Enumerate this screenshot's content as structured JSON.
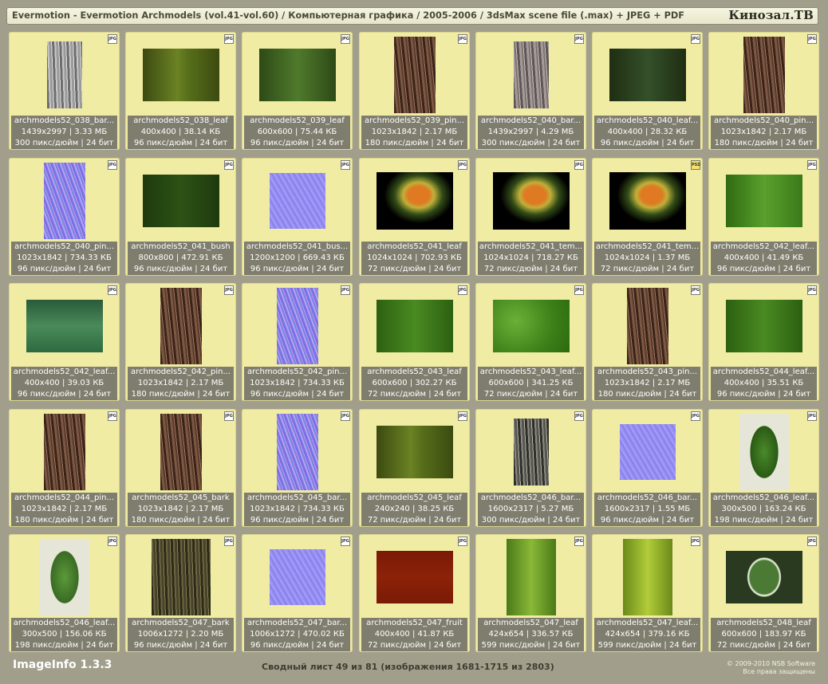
{
  "header": {
    "title": "Evermotion - Evermotion Archmodels (vol.41-vol.60) / Компьютерная графика / 2005-2006 / 3dsMax scene file (.max) + JPEG + PDF",
    "logo": "Кинозал.ТВ"
  },
  "items": [
    {
      "name": "archmodels52_038_bar...",
      "info": "1439x2997 | 3.33 МБ",
      "res": "300 пикс/дюйм | 24 бит",
      "badge": "JPG",
      "tex": "bark-gray"
    },
    {
      "name": "archmodels52_038_leaf",
      "info": "400x400 | 38.14 КБ",
      "res": "96 пикс/дюйм | 24 бит",
      "badge": "JPG",
      "tex": "green-olive"
    },
    {
      "name": "archmodels52_039_leaf",
      "info": "600x600 | 75.44 КБ",
      "res": "96 пикс/дюйм | 24 бит",
      "badge": "JPG",
      "tex": "green-mid"
    },
    {
      "name": "archmodels52_039_pin...",
      "info": "1023x1842 | 2.17 МБ",
      "res": "180 пикс/дюйм | 24 бит",
      "badge": "JPG",
      "tex": "bark-brown"
    },
    {
      "name": "archmodels52_040_bar...",
      "info": "1439x2997 | 4.29 МБ",
      "res": "300 пикс/дюйм | 24 бит",
      "badge": "JPG",
      "tex": "bark-gray-brown"
    },
    {
      "name": "archmodels52_040_leaf...",
      "info": "400x400 | 28.32 КБ",
      "res": "96 пикс/дюйм | 24 бит",
      "badge": "JPG",
      "tex": "green-dark"
    },
    {
      "name": "archmodels52_040_pin...",
      "info": "1023x1842 | 2.17 МБ",
      "res": "180 пикс/дюйм | 24 бит",
      "badge": "JPG",
      "tex": "bark-brown"
    },
    {
      "name": "archmodels52_040_pin...",
      "info": "1023x1842 | 734.33 КБ",
      "res": "96 пикс/дюйм | 24 бит",
      "badge": "JPG",
      "tex": "normal-blue"
    },
    {
      "name": "archmodels52_041_bush",
      "info": "800x800 | 472.91 КБ",
      "res": "96 пикс/дюйм | 24 бит",
      "badge": "JPG",
      "tex": "green-bush"
    },
    {
      "name": "archmodels52_041_bus...",
      "info": "1200x1200 | 669.43 КБ",
      "res": "96 пикс/дюйм | 24 бит",
      "badge": "JPG",
      "tex": "normal-lavender"
    },
    {
      "name": "archmodels52_041_leaf",
      "info": "1024x1024 | 702.93 КБ",
      "res": "72 пикс/дюйм | 24 бит",
      "badge": "JPG",
      "tex": "flower"
    },
    {
      "name": "archmodels52_041_tem...",
      "info": "1024x1024 | 718.27 КБ",
      "res": "72 пикс/дюйм | 24 бит",
      "badge": "JPG",
      "tex": "flower"
    },
    {
      "name": "archmodels52_041_tem...",
      "info": "1024x1024 | 1.37 МБ",
      "res": "72 пикс/дюйм | 24 бит",
      "badge": "PSD",
      "tex": "flower"
    },
    {
      "name": "archmodels52_042_leaf...",
      "info": "400x400 | 41.49 КБ",
      "res": "96 пикс/дюйм | 24 бит",
      "badge": "JPG",
      "tex": "green-bright"
    },
    {
      "name": "archmodels52_042_leaf...",
      "info": "400x400 | 39.03 КБ",
      "res": "96 пикс/дюйм | 24 бит",
      "badge": "JPG",
      "tex": "green-teal"
    },
    {
      "name": "archmodels52_042_pin...",
      "info": "1023x1842 | 2.17 МБ",
      "res": "180 пикс/дюйм | 24 бит",
      "badge": "JPG",
      "tex": "bark-brown"
    },
    {
      "name": "archmodels52_042_pin...",
      "info": "1023x1842 | 734.33 КБ",
      "res": "96 пикс/дюйм | 24 бит",
      "badge": "JPG",
      "tex": "normal-blue"
    },
    {
      "name": "archmodels52_043_leaf",
      "info": "600x600 | 302.27 КБ",
      "res": "72 пикс/дюйм | 24 бит",
      "badge": "JPG",
      "tex": "green-grass"
    },
    {
      "name": "archmodels52_043_leaf...",
      "info": "600x600 | 341.25 КБ",
      "res": "72 пикс/дюйм | 24 бит",
      "badge": "JPG",
      "tex": "green-moss"
    },
    {
      "name": "archmodels52_043_pin...",
      "info": "1023x1842 | 2.17 МБ",
      "res": "180 пикс/дюйм | 24 бит",
      "badge": "JPG",
      "tex": "bark-brown"
    },
    {
      "name": "archmodels52_044_leaf...",
      "info": "400x400 | 35.51 КБ",
      "res": "96 пикс/дюйм | 24 бит",
      "badge": "JPG",
      "tex": "green-grass"
    },
    {
      "name": "archmodels52_044_pin...",
      "info": "1023x1842 | 2.17 МБ",
      "res": "180 пикс/дюйм | 24 бит",
      "badge": "JPG",
      "tex": "bark-brown"
    },
    {
      "name": "archmodels52_045_bark",
      "info": "1023x1842 | 2.17 МБ",
      "res": "180 пикс/дюйм | 24 бит",
      "badge": "JPG",
      "tex": "bark-brown"
    },
    {
      "name": "archmodels52_045_bar...",
      "info": "1023x1842 | 734.33 КБ",
      "res": "96 пикс/дюйм | 24 бит",
      "badge": "JPG",
      "tex": "normal-blue"
    },
    {
      "name": "archmodels52_045_leaf",
      "info": "240x240 | 38.25 КБ",
      "res": "72 пикс/дюйм | 24 бит",
      "badge": "JPG",
      "tex": "green-olive"
    },
    {
      "name": "archmodels52_046_bar...",
      "info": "1600x2317 | 5.27 МБ",
      "res": "300 пикс/дюйм | 24 бит",
      "badge": "JPG",
      "tex": "bark-gray-dark"
    },
    {
      "name": "archmodels52_046_bar...",
      "info": "1600x2317 | 1.55 МБ",
      "res": "96 пикс/дюйм | 24 бит",
      "badge": "JPG",
      "tex": "normal-lavender"
    },
    {
      "name": "archmodels52_046_leaf...",
      "info": "300x500 | 163.24 КБ",
      "res": "198 пикс/дюйм | 24 бит",
      "badge": "JPG",
      "tex": "leaf"
    },
    {
      "name": "archmodels52_046_leaf...",
      "info": "300x500 | 156.06 КБ",
      "res": "198 пикс/дюйм | 24 бит",
      "badge": "JPG",
      "tex": "leaf-light"
    },
    {
      "name": "archmodels52_047_bark",
      "info": "1006x1272 | 2.20 МБ",
      "res": "96 пикс/дюйм | 24 бит",
      "badge": "JPG",
      "tex": "bark-olive"
    },
    {
      "name": "archmodels52_047_bar...",
      "info": "1006x1272 | 470.02 КБ",
      "res": "96 пикс/дюйм | 24 бит",
      "badge": "JPG",
      "tex": "normal-lavender"
    },
    {
      "name": "archmodels52_047_fruit",
      "info": "400x400 | 41.87 КБ",
      "res": "72 пикс/дюйм | 24 бит",
      "badge": "JPG",
      "tex": "red"
    },
    {
      "name": "archmodels52_047_leaf",
      "info": "424x654 | 336.57 КБ",
      "res": "599 пикс/дюйм | 24 бит",
      "badge": "JPG",
      "tex": "leaf-green"
    },
    {
      "name": "archmodels52_047_leaf...",
      "info": "424x654 | 379.16 КБ",
      "res": "599 пикс/дюйм | 24 бит",
      "badge": "JPG",
      "tex": "leaf-yellow"
    },
    {
      "name": "archmodels52_048_leaf",
      "info": "600x600 | 183.97 КБ",
      "res": "72 пикс/дюйм | 24 бит",
      "badge": "JPG",
      "tex": "oval-leaf"
    }
  ],
  "footer": {
    "app": "ImageInfo 1.3.3",
    "sheet": "Сводный лист 49 из 81 (изображения 1681-1715 из 2803)",
    "copyright": "© 2009-2010 NSB Software",
    "rights": "Все права защищены"
  }
}
